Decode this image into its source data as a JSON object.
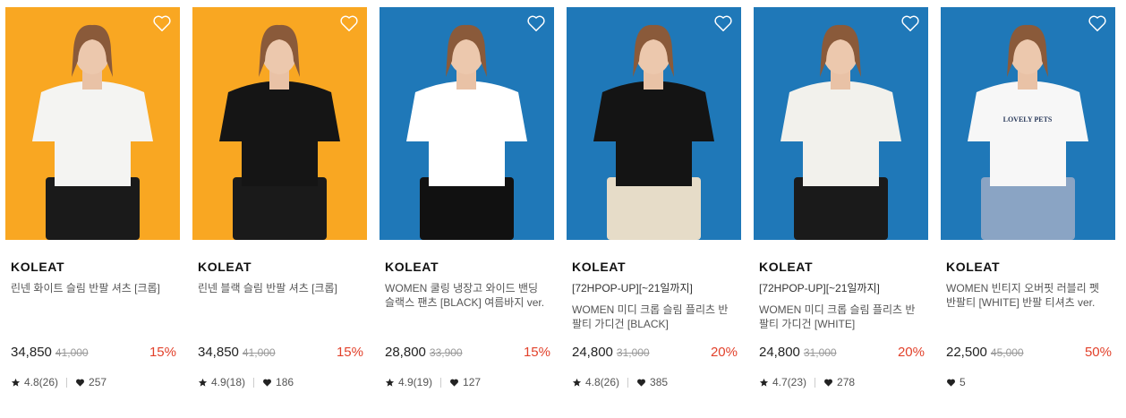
{
  "products": [
    {
      "brand": "KOLEAT",
      "tag": "",
      "name": "린넨 화이트 슬림 반팔 셔츠 [크롭]",
      "price": "34,850",
      "original_price": "41,000",
      "discount": "15%",
      "rating": "4.8(26)",
      "likes": "257",
      "bg_color": "#f9a722",
      "top_color": "#f4f4f2",
      "bottom_color": "#1a1a1a"
    },
    {
      "brand": "KOLEAT",
      "tag": "",
      "name": "린넨 블랙 슬림 반팔 셔츠 [크롭]",
      "price": "34,850",
      "original_price": "41,000",
      "discount": "15%",
      "rating": "4.9(18)",
      "likes": "186",
      "bg_color": "#f9a722",
      "top_color": "#151515",
      "bottom_color": "#1a1a1a"
    },
    {
      "brand": "KOLEAT",
      "tag": "",
      "name": "WOMEN 쿨링 냉장고 와이드 밴딩 슬랙스 팬츠 [BLACK] 여름바지 ver.",
      "price": "28,800",
      "original_price": "33,900",
      "discount": "15%",
      "rating": "4.9(19)",
      "likes": "127",
      "bg_color": "#1f78b8",
      "top_color": "#ffffff",
      "bottom_color": "#111111"
    },
    {
      "brand": "KOLEAT",
      "tag": "[72HPOP-UP][~21일까지]",
      "name": "WOMEN 미디 크롭 슬림 플리츠 반팔티 가디건 [BLACK]",
      "price": "24,800",
      "original_price": "31,000",
      "discount": "20%",
      "rating": "4.8(26)",
      "likes": "385",
      "bg_color": "#1f78b8",
      "top_color": "#141414",
      "bottom_color": "#e6dcc8"
    },
    {
      "brand": "KOLEAT",
      "tag": "[72HPOP-UP][~21일까지]",
      "name": "WOMEN 미디 크롭 슬림 플리츠 반팔티 가디건 [WHITE]",
      "price": "24,800",
      "original_price": "31,000",
      "discount": "20%",
      "rating": "4.7(23)",
      "likes": "278",
      "bg_color": "#1f78b8",
      "top_color": "#f2f1ec",
      "bottom_color": "#1a1a1a"
    },
    {
      "brand": "KOLEAT",
      "tag": "",
      "name": "WOMEN 빈티지 오버핏 러블리 펫 반팔티 [WHITE] 반팔 티셔츠 ver.",
      "price": "22,500",
      "original_price": "45,000",
      "discount": "50%",
      "rating": "",
      "likes": "5",
      "bg_color": "#1f78b8",
      "top_color": "#f7f7f7",
      "bottom_color": "#8aa4c4",
      "print_text": "LOVELY PETS"
    }
  ],
  "icons": {
    "wishlist": "heart-outline-icon",
    "rating": "star-icon",
    "likes": "heart-filled-icon"
  },
  "colors": {
    "discount": "#e2412b",
    "price": "#222222",
    "original_price": "#999999"
  }
}
